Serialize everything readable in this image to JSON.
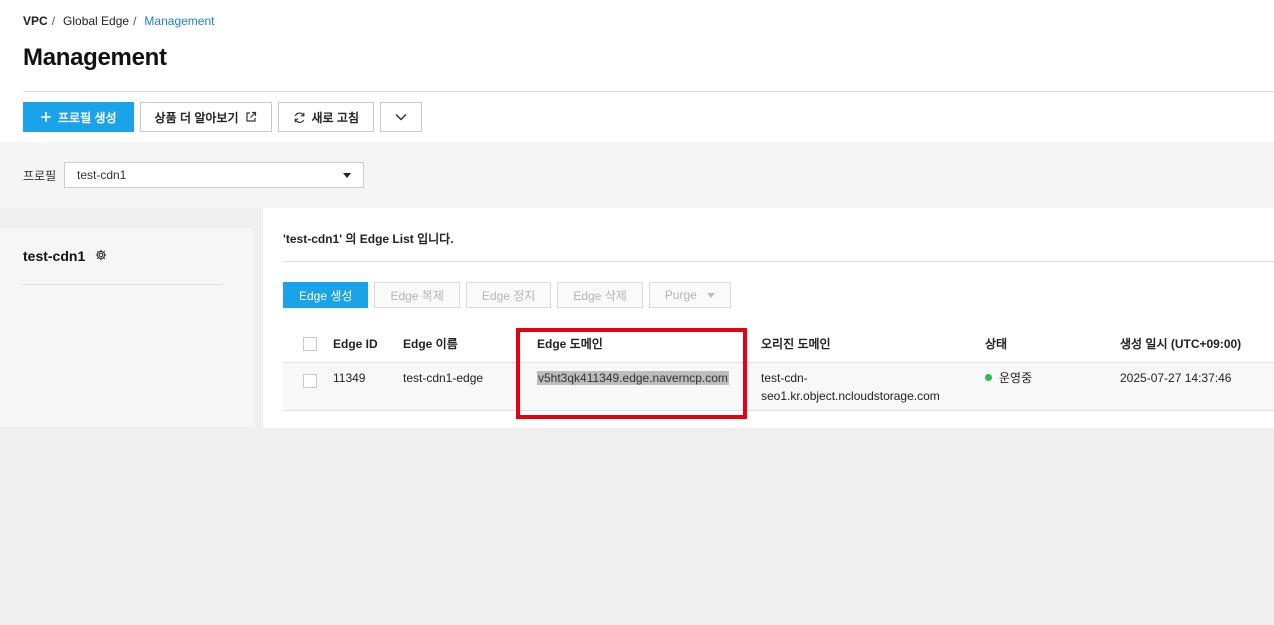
{
  "breadcrumb": {
    "items": [
      "VPC",
      "Global Edge",
      "Management"
    ]
  },
  "page_title": "Management",
  "toolbar": {
    "create_profile": "프로필 생성",
    "learn_more": "상품 더 알아보기",
    "refresh": "새로 고침"
  },
  "filter": {
    "label": "프로필",
    "selected_profile": "test-cdn1"
  },
  "profile_panel": {
    "name": "test-cdn1"
  },
  "edge_list": {
    "title": "'test-cdn1' 의 Edge List 입니다.",
    "actions": {
      "create": "Edge 생성",
      "copy": "Edge 복제",
      "stop": "Edge 정지",
      "delete": "Edge 삭제",
      "purge": "Purge"
    },
    "columns": {
      "edge_id": "Edge ID",
      "edge_name": "Edge 이름",
      "edge_domain": "Edge 도메인",
      "origin_domain": "오리진 도메인",
      "status": "상태",
      "created": "생성 일시 (UTC+09:00)"
    },
    "rows": [
      {
        "edge_id": "11349",
        "edge_name": "test-cdn1-edge",
        "edge_domain": "v5ht3qk411349.edge.naverncp.com",
        "origin_domain_line1": "test-cdn-",
        "origin_domain_line2": "seo1.kr.object.ncloudstorage.com",
        "status": "운영중",
        "created": "2025-07-27 14:37:46"
      }
    ]
  },
  "colors": {
    "primary": "#1aa3e8",
    "highlight_box": "#e60012",
    "status_running": "#2bbd4e",
    "breadcrumb_current": "#1a7fd0"
  }
}
